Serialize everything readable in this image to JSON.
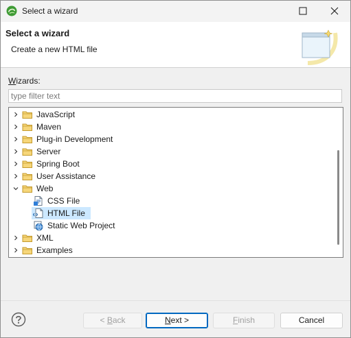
{
  "window": {
    "title": "Select a wizard"
  },
  "banner": {
    "title": "Select a wizard",
    "message": "Create a new HTML file"
  },
  "wizards": {
    "label_mnemonic": "W",
    "label_rest": "izards:",
    "filter_placeholder": "type filter text",
    "filter_value": "",
    "tree": [
      {
        "label": "JavaScript",
        "icon": "folder-icon",
        "expanded": false
      },
      {
        "label": "Maven",
        "icon": "folder-icon",
        "expanded": false
      },
      {
        "label": "Plug-in Development",
        "icon": "folder-icon",
        "expanded": false
      },
      {
        "label": "Server",
        "icon": "folder-icon",
        "expanded": false
      },
      {
        "label": "Spring Boot",
        "icon": "folder-icon",
        "expanded": false
      },
      {
        "label": "User Assistance",
        "icon": "folder-icon",
        "expanded": false
      },
      {
        "label": "Web",
        "icon": "folder-icon",
        "expanded": true
      },
      {
        "label": "CSS File",
        "icon": "css-file-icon",
        "child": true
      },
      {
        "label": "HTML File",
        "icon": "html-file-icon",
        "child": true,
        "selected": true
      },
      {
        "label": "Static Web Project",
        "icon": "web-project-icon",
        "child": true
      },
      {
        "label": "XML",
        "icon": "folder-icon",
        "expanded": false
      },
      {
        "label": "Examples",
        "icon": "folder-icon",
        "expanded": false
      }
    ]
  },
  "buttons": {
    "back": {
      "mnemonic": "B",
      "prefix": "< ",
      "rest": "ack",
      "enabled": false
    },
    "next": {
      "mnemonic": "N",
      "rest": "ext >",
      "enabled": true
    },
    "finish": {
      "mnemonic": "F",
      "rest": "inish",
      "enabled": false
    },
    "cancel": {
      "label": "Cancel",
      "enabled": true
    }
  },
  "colors": {
    "selection": "#cce8ff",
    "default_button_border": "#0067c0",
    "folder": "#e8b84a",
    "eclipse_green": "#3f9b35"
  }
}
